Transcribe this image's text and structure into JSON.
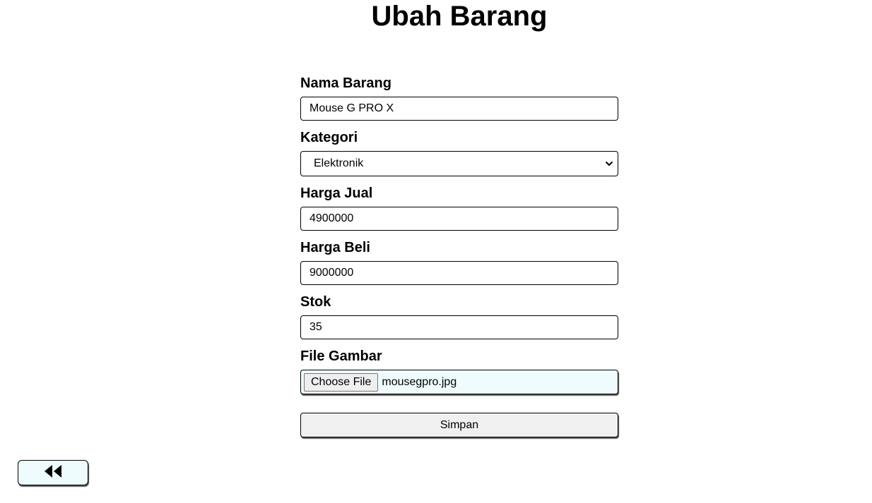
{
  "page": {
    "title": "Ubah Barang"
  },
  "form": {
    "nama_barang": {
      "label": "Nama Barang",
      "value": "Mouse G PRO X"
    },
    "kategori": {
      "label": "Kategori",
      "selected": "Elektronik"
    },
    "harga_jual": {
      "label": "Harga Jual",
      "value": "4900000"
    },
    "harga_beli": {
      "label": "Harga Beli",
      "value": "9000000"
    },
    "stok": {
      "label": "Stok",
      "value": "35"
    },
    "file_gambar": {
      "label": "File Gambar",
      "button_label": "Choose File",
      "file_name": "mousegpro.jpg"
    },
    "submit_label": "Simpan"
  },
  "back_button": {
    "icon": "fast-backward-icon"
  }
}
